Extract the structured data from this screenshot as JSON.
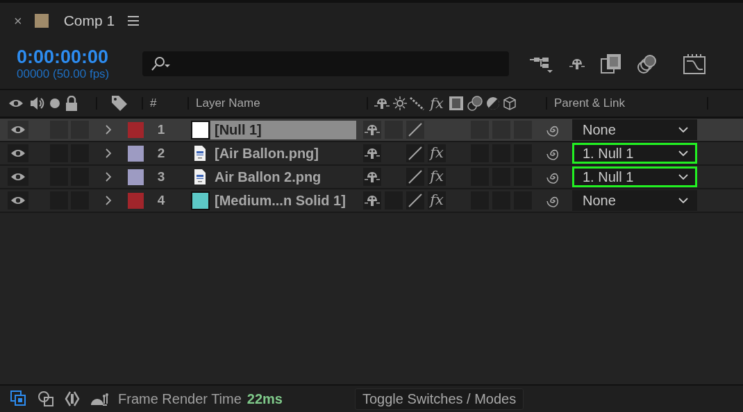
{
  "panel": {
    "close": "×",
    "title": "Comp 1",
    "timecode": "0:00:00:00",
    "frame_info": "00000 (50.00 fps)"
  },
  "columns": {
    "number": "#",
    "layer_name": "Layer Name",
    "effects": "fx",
    "parent": "Parent & Link"
  },
  "layers": [
    {
      "number": "1",
      "name": "[Null 1]",
      "color": "#a1252b",
      "source": {
        "kind": "solid",
        "color": "#ffffff"
      },
      "selected": true,
      "switch_box": true,
      "parent": "None",
      "highlighted": false
    },
    {
      "number": "2",
      "name": "[Air Ballon.png]",
      "color": "#9d9bc2",
      "source": {
        "kind": "file"
      },
      "selected": false,
      "switch_box": false,
      "effects_switch": "fx",
      "parent": "1. Null 1",
      "highlighted": true
    },
    {
      "number": "3",
      "name": "Air Ballon 2.png",
      "color": "#9d9bc2",
      "source": {
        "kind": "file"
      },
      "selected": false,
      "switch_box": false,
      "effects_switch": "fx",
      "parent": "1. Null 1",
      "highlighted": true
    },
    {
      "number": "4",
      "name": "[Medium...n Solid 1]",
      "color": "#a1252b",
      "source": {
        "kind": "solid",
        "color": "#5cc8c6"
      },
      "selected": false,
      "switch_box": true,
      "effects_switch": "fx",
      "parent": "None",
      "highlighted": false
    }
  ],
  "footer": {
    "label": "Frame Render Time",
    "value": "22ms",
    "toggle_button": "Toggle Switches / Modes"
  }
}
